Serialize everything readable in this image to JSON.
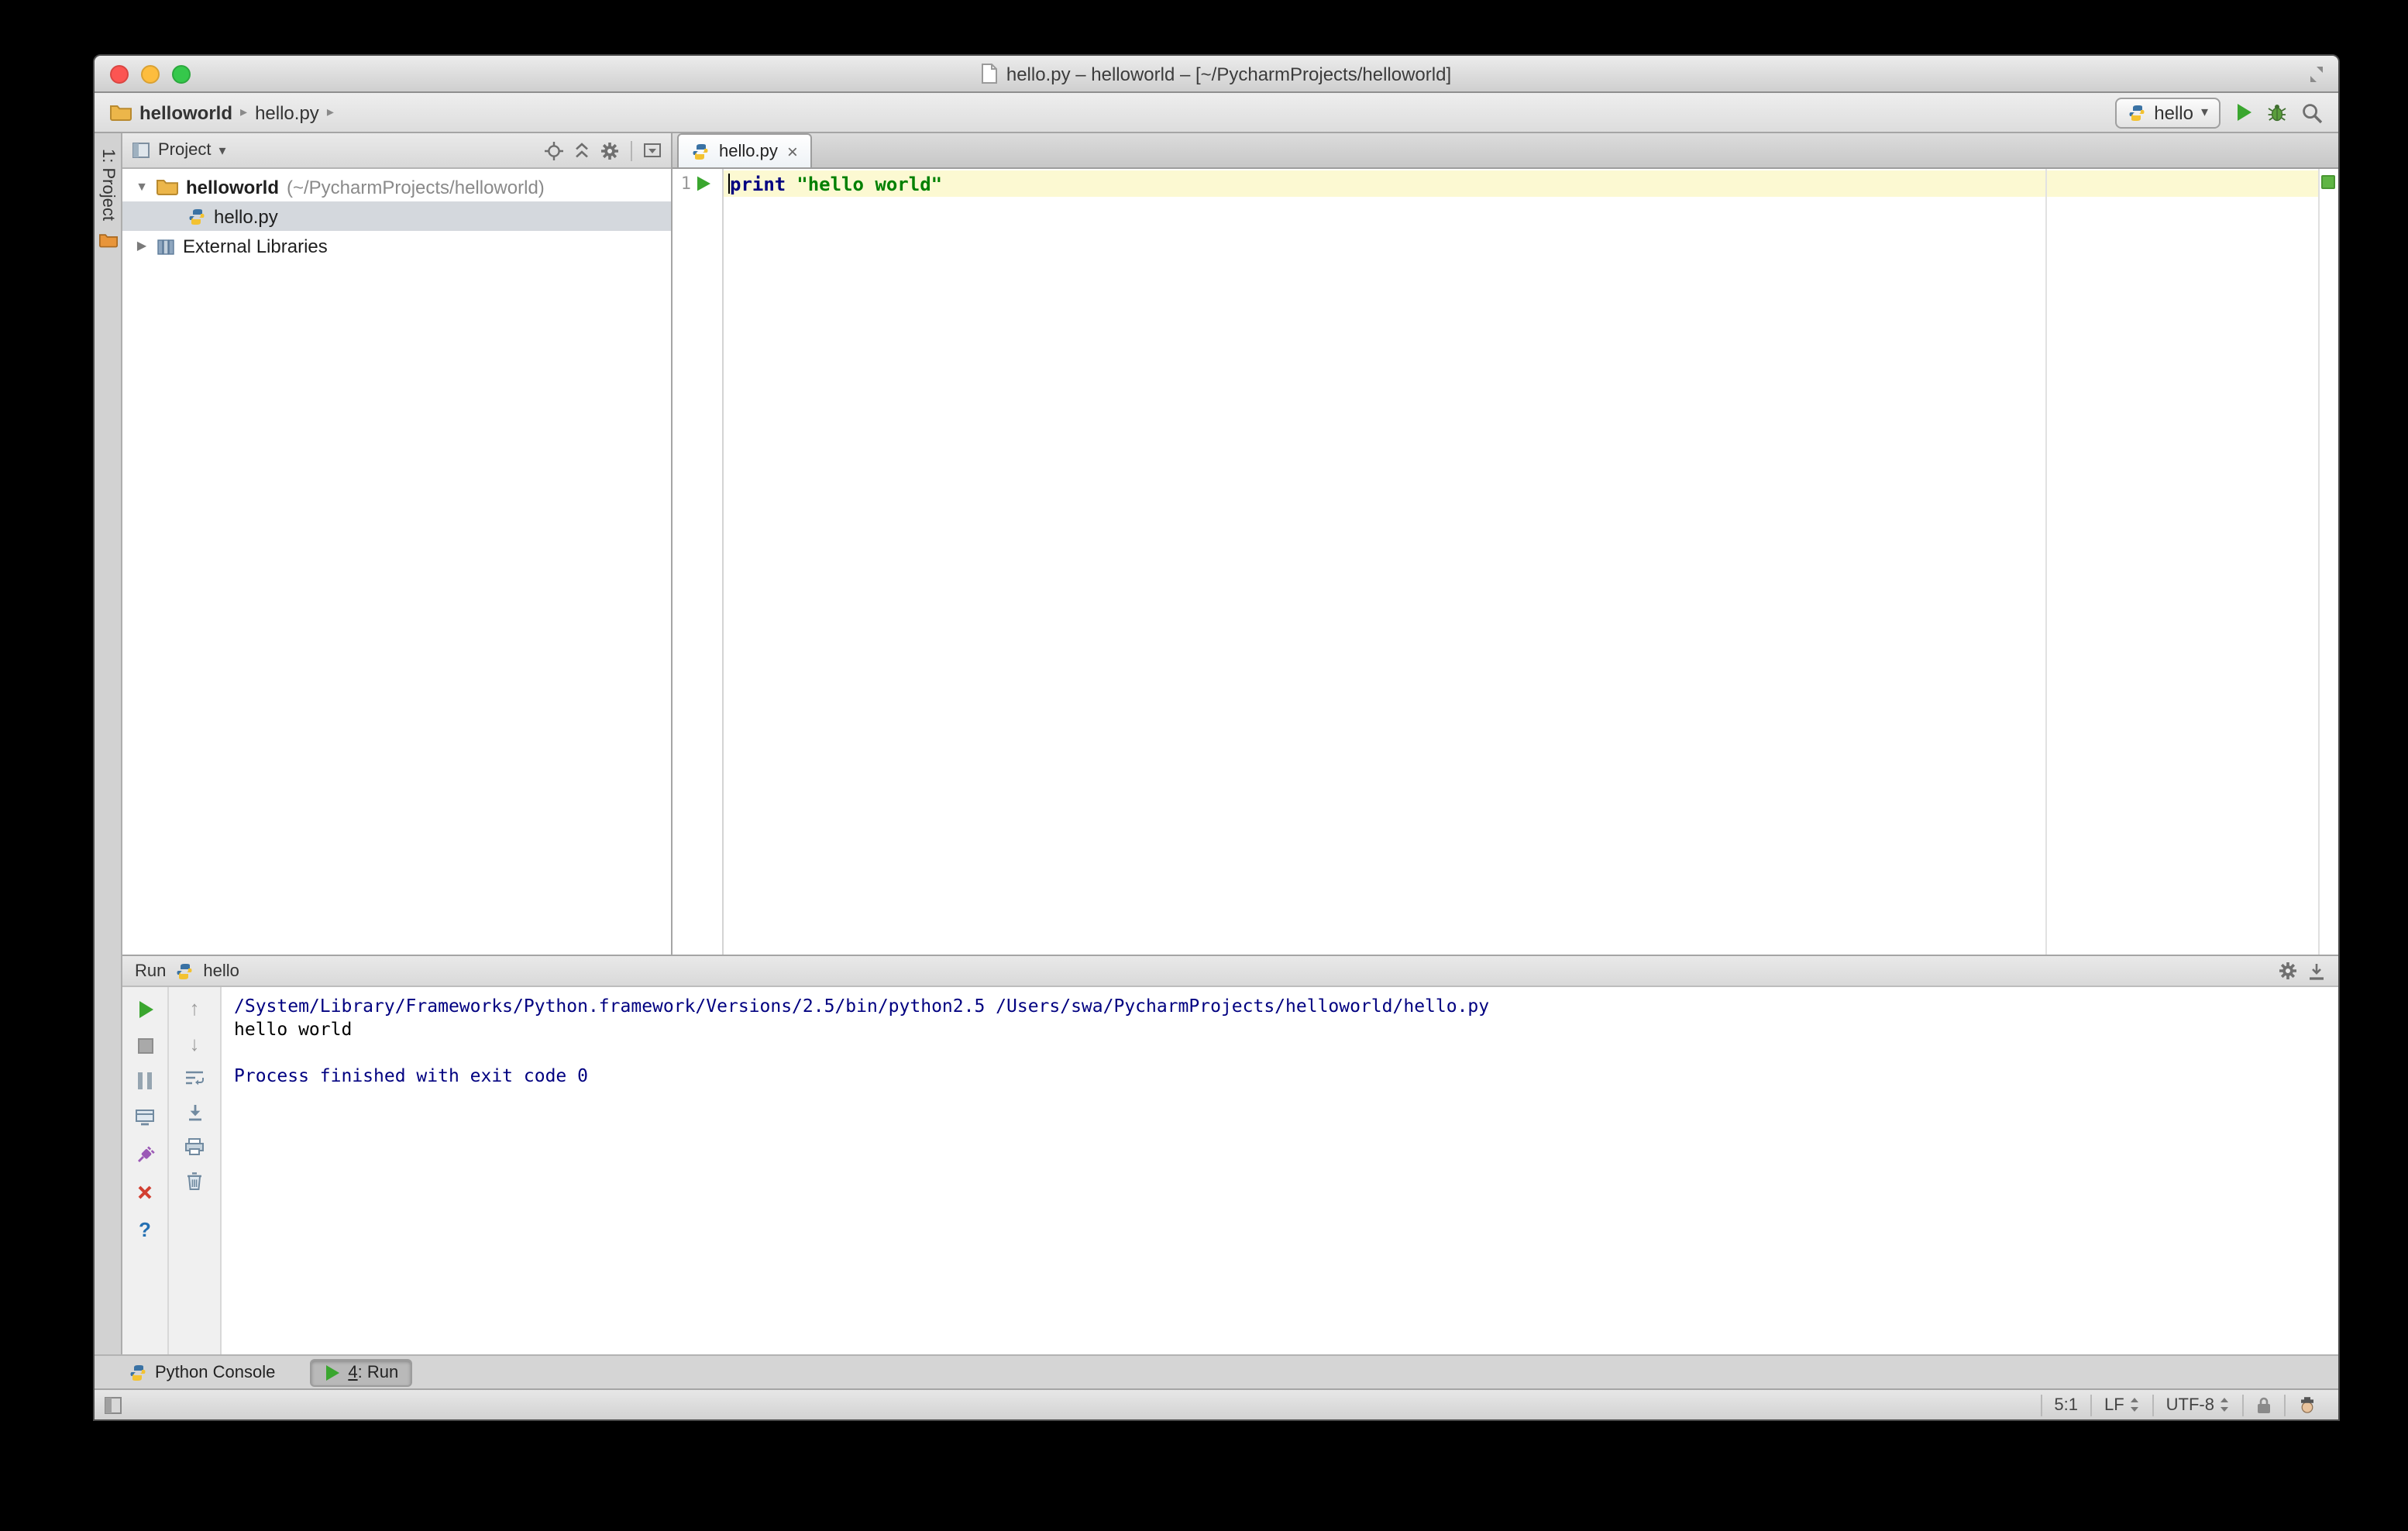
{
  "colors": {
    "keyword": "#000080",
    "string": "#008000",
    "console-info": "#000080",
    "current-line": "#fcf9d2",
    "selection": "#d4d8dd",
    "run-green": "#3aa62f"
  },
  "icons": {
    "chevron": "▸",
    "dropdown": "▾",
    "tree_expanded": "▼",
    "tree_collapsed": "▶",
    "up_arrow": "↑",
    "down_arrow": "↓",
    "help": "?",
    "tab_close": "×"
  },
  "titlebar": {
    "title": "hello.py – helloworld – [~/PycharmProjects/helloworld]"
  },
  "navbar": {
    "breadcrumb": {
      "project": "helloworld",
      "file": "hello.py"
    },
    "run_config": "hello"
  },
  "left_stripe": {
    "project_button": "1: Project"
  },
  "project_panel": {
    "header_title": "Project",
    "root_name": "helloworld",
    "root_path": "(~/PycharmProjects/helloworld)",
    "file_name": "hello.py",
    "external_libraries": "External Libraries"
  },
  "editor": {
    "tab_title": "hello.py",
    "line_number": "1",
    "code_keyword": "print",
    "code_string": "\"hello world\""
  },
  "run_panel": {
    "title": "Run",
    "config_name": "hello",
    "console": {
      "line1": "/System/Library/Frameworks/Python.framework/Versions/2.5/bin/python2.5 /Users/swa/PycharmProjects/helloworld/hello.py",
      "line2": "hello world",
      "line3": "",
      "line4": "Process finished with exit code 0"
    }
  },
  "bottom_bar": {
    "python_console": "Python Console",
    "run_tab_number": "4",
    "run_tab_suffix": ": Run"
  },
  "status_bar": {
    "caret_position": "5:1",
    "line_separator": "LF",
    "encoding": "UTF-8"
  }
}
